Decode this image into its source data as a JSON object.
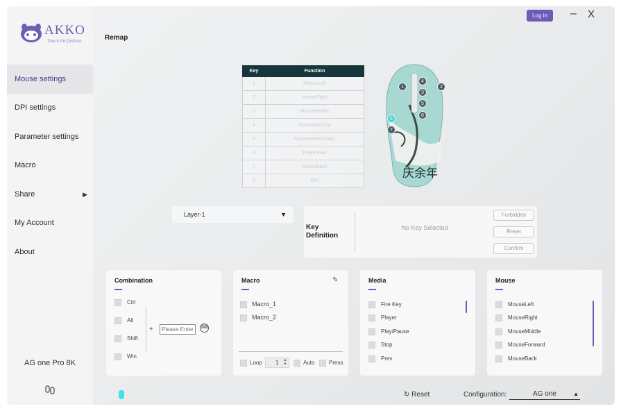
{
  "header": {
    "login_label": "Log in",
    "minimize_label": "–",
    "close_label": "X"
  },
  "logo": {
    "brand": "Akko",
    "tagline": "Touch the fashion"
  },
  "sidebar": {
    "items": [
      {
        "label": "Mouse settings"
      },
      {
        "label": "DPI settings"
      },
      {
        "label": "Parameter settings"
      },
      {
        "label": "Macro"
      },
      {
        "label": "Share"
      },
      {
        "label": "My Account"
      },
      {
        "label": "About"
      }
    ],
    "device_name": "AG one Pro 8K"
  },
  "main": {
    "title": "Remap",
    "key_table": {
      "headers": [
        "Key",
        "Function"
      ],
      "rows": [
        {
          "key": "1",
          "function": "MouseLeft"
        },
        {
          "key": "2",
          "function": "MouseRight"
        },
        {
          "key": "3",
          "function": "MouseMiddle"
        },
        {
          "key": "4",
          "function": "MouseMackUp"
        },
        {
          "key": "5",
          "function": "MouseWheelDown"
        },
        {
          "key": "6",
          "function": "PlayPause"
        },
        {
          "key": "7",
          "function": "MouseBack"
        },
        {
          "key": "8",
          "function": "DPI"
        }
      ]
    },
    "mouse_badges": [
      "1",
      "2",
      "3",
      "4",
      "5",
      "6",
      "7",
      "8"
    ],
    "mouse_art_text": "庆余年",
    "layer_select": "Layer-1",
    "key_definition": {
      "title": "Key Definition",
      "empty_text": "No Key Selected",
      "buttons": [
        "Forbidden",
        "Reset",
        "Confirm"
      ]
    }
  },
  "panels": {
    "combination": {
      "title": "Combination",
      "modifiers": [
        "Ctrl",
        "Alt",
        "Shift",
        "Win"
      ],
      "plus": "+",
      "input_placeholder": "Please Enter"
    },
    "macro": {
      "title": "Macro",
      "items": [
        "Macro_1",
        "Macro_2"
      ],
      "loop_label": "Loop",
      "loop_value": "1",
      "auto_label": "Auto",
      "press_label": "Press"
    },
    "media": {
      "title": "Media",
      "items": [
        "Fire Key",
        "Player",
        "Play/Pause",
        "Stop",
        "Prev"
      ]
    },
    "mouse": {
      "title": "Mouse",
      "items": [
        "MouseLeft",
        "MouseRight",
        "MouseMiddle",
        "MouseForward",
        "MouseBack"
      ]
    }
  },
  "footer": {
    "reset_label": "Reset",
    "config_label": "Configuration:",
    "config_value": "AG one"
  },
  "colors": {
    "accent": "#6d5bb5",
    "table_header": "#15363a",
    "mouse_status": "#3ee0ea"
  }
}
